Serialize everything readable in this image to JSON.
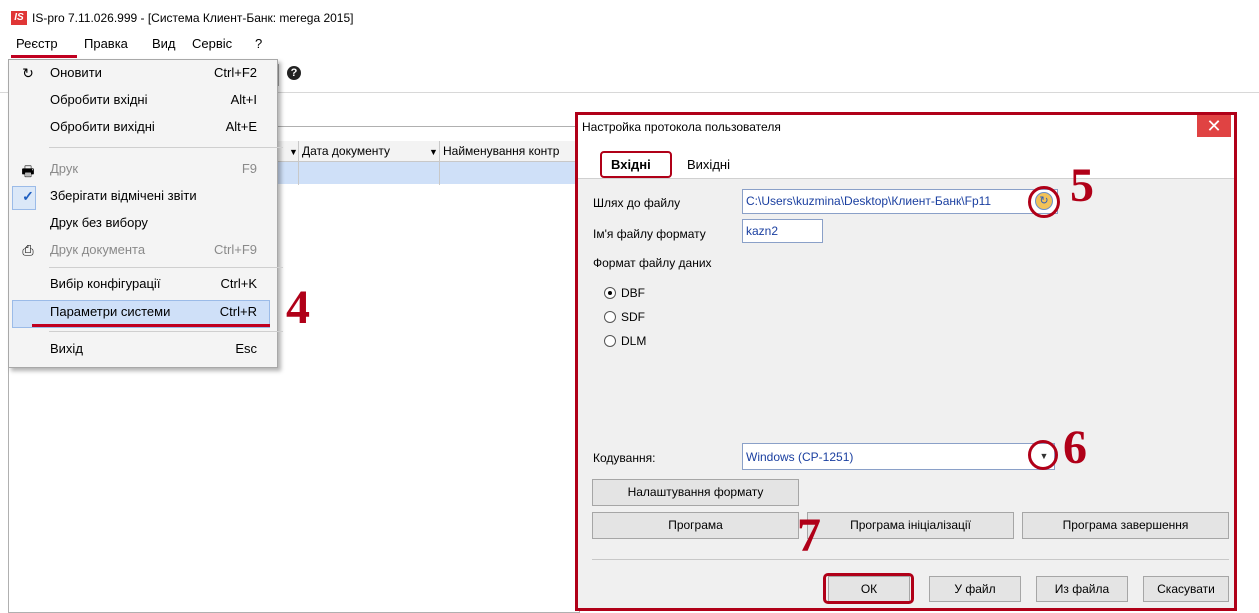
{
  "window": {
    "title": "IS-pro 7.11.026.999 - [Система Клиент-Банк: merega 2015]",
    "logo_text": "IS"
  },
  "menubar": {
    "items": [
      "Реєстр",
      "Правка",
      "Вид",
      "Сервіс",
      "?"
    ]
  },
  "grid": {
    "columns": [
      "Дата документу",
      "Найменування контр"
    ]
  },
  "dropdown": {
    "items": [
      {
        "label": "Оновити",
        "shortcut": "Ctrl+F2",
        "icon": "refresh-icon",
        "disabled": false
      },
      {
        "label": "Обробити вхідні",
        "shortcut": "Alt+I",
        "icon": "",
        "disabled": false
      },
      {
        "label": "Обробити вихідні",
        "shortcut": "Alt+E",
        "icon": "",
        "disabled": false
      },
      {
        "label": "Друк",
        "shortcut": "F9",
        "icon": "printer-icon",
        "disabled": true
      },
      {
        "label": "Зберігати відмічені звіти",
        "shortcut": "",
        "icon": "check-icon",
        "disabled": false
      },
      {
        "label": "Друк без вибору",
        "shortcut": "",
        "icon": "",
        "disabled": false
      },
      {
        "label": "Друк документа",
        "shortcut": "Ctrl+F9",
        "icon": "print-document-icon",
        "disabled": true
      },
      {
        "label": "Вибір конфігурації",
        "shortcut": "Ctrl+K",
        "icon": "",
        "disabled": false
      },
      {
        "label": "Параметри системи",
        "shortcut": "Ctrl+R",
        "icon": "",
        "disabled": false
      },
      {
        "label": "Вихід",
        "shortcut": "Esc",
        "icon": "",
        "disabled": false
      }
    ]
  },
  "annotations": [
    "4",
    "5",
    "6",
    "7"
  ],
  "dialog": {
    "title": "Настройка протокола пользователя",
    "close_glyph": "✕",
    "tabs": [
      "Вхідні",
      "Вихідні"
    ],
    "path_label": "Шлях до файлу",
    "path_value": "C:\\Users\\kuzmina\\Desktop\\Клиент-Банк\\Fp11",
    "format_file_label": "Ім'я файлу формату",
    "format_file_value": "kazn2",
    "data_format_label": "Формат файлу даних",
    "formats": [
      {
        "label": "DBF",
        "checked": true
      },
      {
        "label": "SDF",
        "checked": false
      },
      {
        "label": "DLM",
        "checked": false
      }
    ],
    "encoding_label": "Кодування:",
    "encoding_value": "Windows (CP-1251)",
    "format_settings_button": "Налаштування формату",
    "program_buttons": [
      "Програма",
      "Програма ініціалізації",
      "Програма завершення"
    ],
    "footer_buttons": [
      "ОК",
      "У файл",
      "Из файла",
      "Скасувати"
    ]
  },
  "colors": {
    "accent_red": "#b00018",
    "selection_blue": "#cfe0f8",
    "field_text_blue": "#1a3fa0"
  }
}
